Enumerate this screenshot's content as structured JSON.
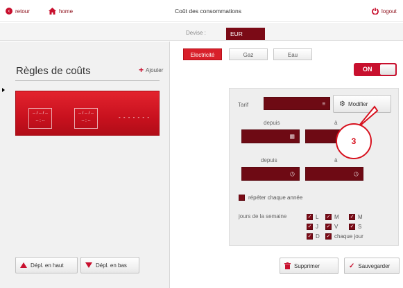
{
  "topbar": {
    "back_label": "retour",
    "home_label": "home",
    "title": "Coût des consommations",
    "logout_label": "logout"
  },
  "currency": {
    "label": "Devise :",
    "value": "EUR"
  },
  "rules": {
    "title": "Règles de coûts",
    "add_label": "Ajouter",
    "card": {
      "block1_line1": "-- / -- / --",
      "block1_line2": "-- : --",
      "block2_line1": "-- / -- / --",
      "block2_line2": "-- : --",
      "dots": "- - - - - - -"
    }
  },
  "left_buttons": {
    "move_up": "Dépl. en haut",
    "move_down": "Dépl. en bas"
  },
  "tabs": [
    {
      "label": "Electricité",
      "active": true
    },
    {
      "label": "Gaz",
      "active": false
    },
    {
      "label": "Eau",
      "active": false
    }
  ],
  "toggle": {
    "label": "ON",
    "state": "on"
  },
  "form": {
    "tarif_label": "Tarif",
    "tarif_value": "",
    "modifier_label": "Modifier",
    "depuis_label_1": "depuis",
    "a_label_1": "à",
    "depuis_label_2": "depuis",
    "a_label_2": "à",
    "repeat_label": "répéter chaque année",
    "days_label": "jours de la semaine",
    "days": [
      {
        "label": "L",
        "checked": true
      },
      {
        "label": "M",
        "checked": true
      },
      {
        "label": "M",
        "checked": true
      },
      {
        "label": "J",
        "checked": true
      },
      {
        "label": "V",
        "checked": true
      },
      {
        "label": "S",
        "checked": true
      },
      {
        "label": "D",
        "checked": true
      },
      {
        "label": "chaque jour",
        "checked": true
      }
    ]
  },
  "annotation": {
    "number": "3"
  },
  "bottom_buttons": {
    "delete": "Supprimer",
    "save": "Sauvegarder"
  },
  "icons": {
    "back": "circle-chevron-left-icon",
    "home": "home-icon",
    "logout": "power-icon",
    "add": "plus-icon",
    "gear": "gears-icon",
    "calendar": "calendar-icon",
    "clock": "clock-icon",
    "trash": "trash-icon",
    "check": "check-icon"
  },
  "colors": {
    "accent_red": "#c8102e",
    "dark_red": "#6e0a14"
  }
}
